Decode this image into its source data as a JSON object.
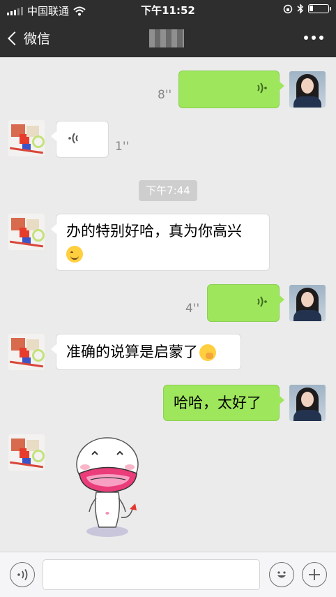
{
  "status_bar": {
    "carrier": "中国联通",
    "time": "下午11:52",
    "battery_level": 0.2
  },
  "nav": {
    "back_label": "微信"
  },
  "messages": [
    {
      "side": "right",
      "type": "voice",
      "duration": "8''"
    },
    {
      "side": "left",
      "type": "voice",
      "duration": "1''"
    },
    {
      "type": "time",
      "text": "下午7:44"
    },
    {
      "side": "left",
      "type": "text",
      "text": "办的特别好哈，真为你高兴",
      "emoji": "smile-emoji"
    },
    {
      "side": "right",
      "type": "voice",
      "duration": "4''"
    },
    {
      "side": "left",
      "type": "text",
      "text": "准确的说算是启蒙了",
      "emoji": "shy-emoji"
    },
    {
      "side": "right",
      "type": "text",
      "text": "哈哈，太好了"
    },
    {
      "side": "left",
      "type": "sticker",
      "sticker": "pink-mouth-cartoon-sticker"
    }
  ],
  "input_bar": {
    "placeholder": "",
    "icons": [
      "voice-input-icon",
      "emoji-icon",
      "plus-icon"
    ]
  },
  "colors": {
    "bar_bg": "#2e2e2e",
    "chat_bg": "#ebebeb",
    "sent_bubble": "#9ee65c",
    "received_bubble": "#ffffff"
  }
}
